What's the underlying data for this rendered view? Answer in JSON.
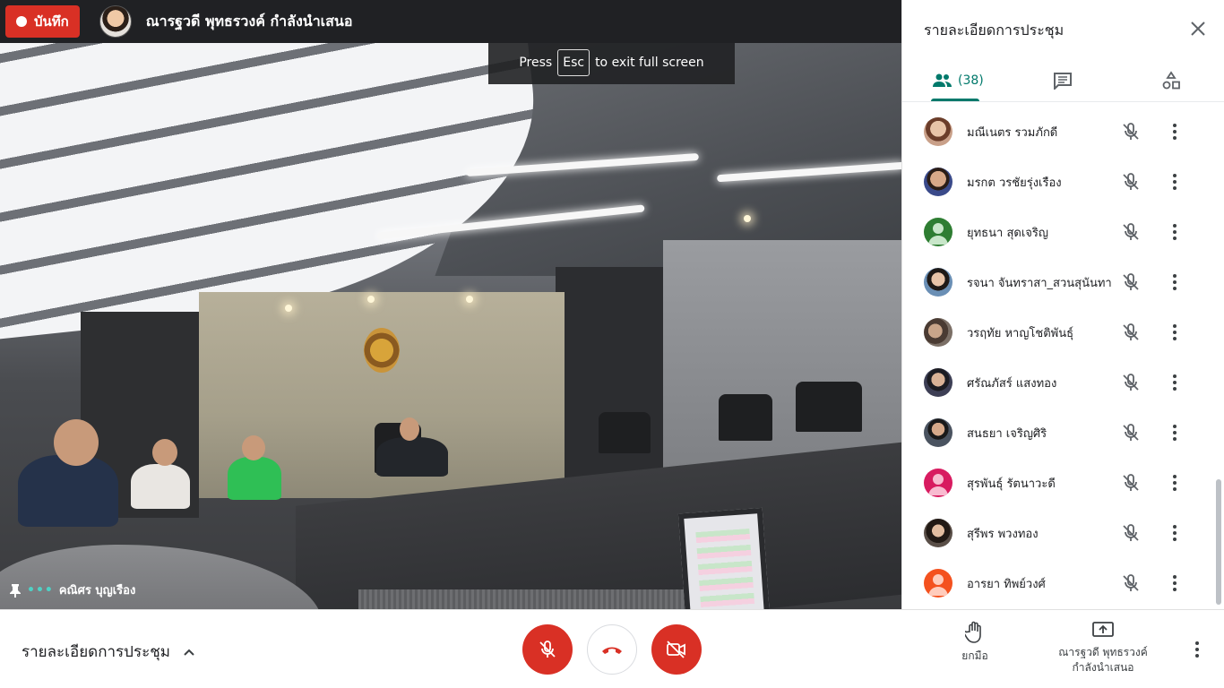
{
  "topbar": {
    "record_label": "บันทึก",
    "presenter_text": "ณารฐวดี พุทธรวงค์ กำลังนำเสนอ"
  },
  "banner": {
    "press": "Press",
    "key": "Esc",
    "rest": "to exit full screen"
  },
  "tile": {
    "name": "คณิศร บุญเรือง"
  },
  "panel": {
    "title": "รายละเอียดการประชุม",
    "people_count": "(38)",
    "participants": [
      {
        "name": "มณีเนตร รวมภักดี",
        "avatar_color": "#c9a089"
      },
      {
        "name": "มรกต วรชัยรุ่งเรือง",
        "avatar_color": "#3a4a8a"
      },
      {
        "name": "ยุทธนา สุดเจริญ",
        "avatar_color": "#2e7d32"
      },
      {
        "name": "รจนา จันทราสา_สวนสุนันทา",
        "avatar_color": "#6a8fb5"
      },
      {
        "name": "วรฤทัย หาญโชติพันธุ์",
        "avatar_color": "#7b6f66"
      },
      {
        "name": "ศรัณภัสร์ แสงทอง",
        "avatar_color": "#3d3f55"
      },
      {
        "name": "สนธยา เจริญศิริ",
        "avatar_color": "#4a5360"
      },
      {
        "name": "สุรพันธุ์ รัตนาวะดี",
        "avatar_color": "#d81b60"
      },
      {
        "name": "สุรีพร พวงทอง",
        "avatar_color": "#5a4f48"
      },
      {
        "name": "อารยา ทิพย์วงศ์",
        "avatar_color": "#f4511e"
      }
    ]
  },
  "bottom": {
    "meeting_details": "รายละเอียดการประชุม",
    "raise_hand": "ยกมือ",
    "present_line1": "ณารฐวดี พุทธรวงค์",
    "present_line2": "กำลังนำเสนอ"
  },
  "colors": {
    "accent": "#00796b",
    "danger": "#d93025"
  }
}
